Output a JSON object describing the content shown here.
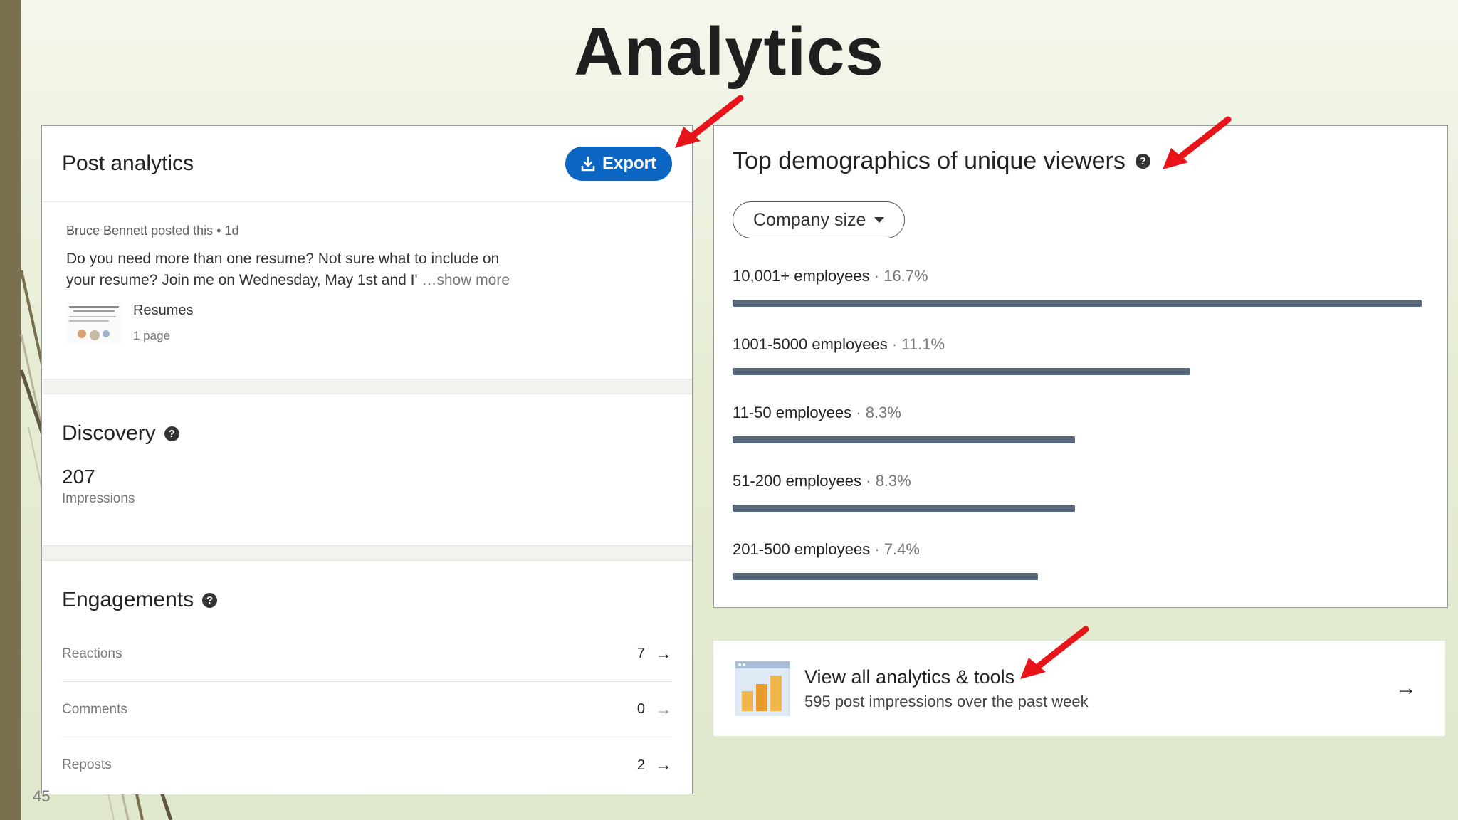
{
  "slide": {
    "title": "Analytics",
    "page_number": "45"
  },
  "post_analytics": {
    "title": "Post analytics",
    "export_label": "Export",
    "post": {
      "author": "Bruce Bennett",
      "meta_suffix": " posted this • 1d",
      "text": "Do you need more than one resume? Not sure what to include on your resume? Join me on Wednesday, May 1st and I'",
      "show_more": "…show more",
      "document_name": "Resumes",
      "document_pages": "1 page"
    },
    "discovery": {
      "title": "Discovery",
      "impressions_value": "207",
      "impressions_label": "Impressions"
    },
    "engagements": {
      "title": "Engagements",
      "rows": [
        {
          "label": "Reactions",
          "value": "7"
        },
        {
          "label": "Comments",
          "value": "0"
        },
        {
          "label": "Reposts",
          "value": "2"
        }
      ]
    }
  },
  "demographics": {
    "title": "Top demographics of unique viewers",
    "filter_label": "Company size",
    "items": [
      {
        "label": "10,001+ employees",
        "pct": "16.7%",
        "value": 16.7
      },
      {
        "label": "1001-5000 employees",
        "pct": "11.1%",
        "value": 11.1
      },
      {
        "label": "11-50 employees",
        "pct": "8.3%",
        "value": 8.3
      },
      {
        "label": "51-200 employees",
        "pct": "8.3%",
        "value": 8.3
      },
      {
        "label": "201-500 employees",
        "pct": "7.4%",
        "value": 7.4
      }
    ]
  },
  "tools_card": {
    "title": "View all analytics & tools",
    "subtitle": "595 post impressions over the past week"
  },
  "colors": {
    "accent": "#0a66c2",
    "bar": "#56687a",
    "annotation_arrow": "#e8141a"
  }
}
